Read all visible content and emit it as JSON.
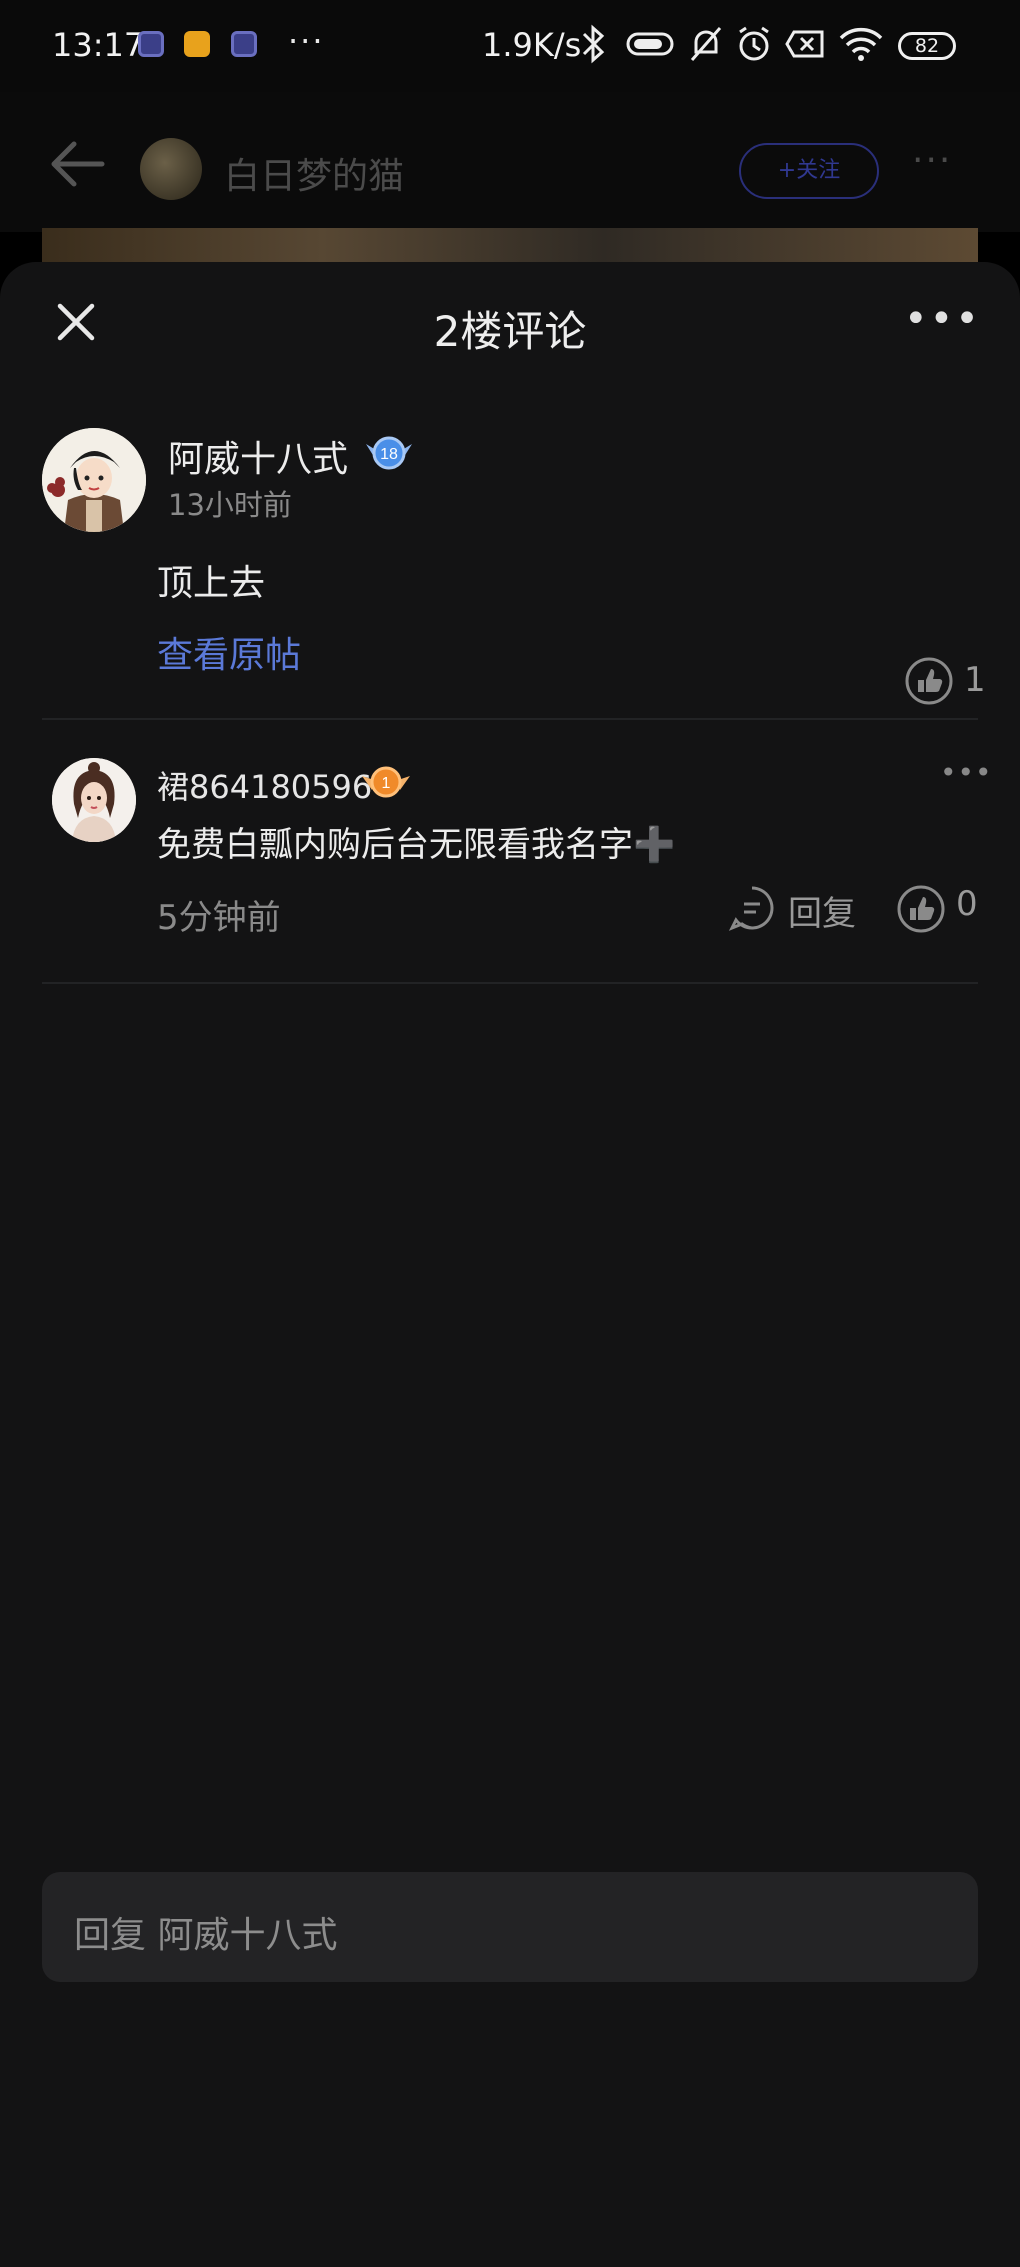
{
  "status_bar": {
    "time": "13:17",
    "more": "···",
    "net_speed": "1.9K/s",
    "battery": "82"
  },
  "background_header": {
    "name": "白日梦的猫",
    "follow_label": "+关注",
    "more": "···"
  },
  "sheet": {
    "title": "2楼评论",
    "more": "•••"
  },
  "main_comment": {
    "author": "阿威十八式",
    "level": "18",
    "time": "13小时前",
    "content": "顶上去",
    "view_original": "查看原帖",
    "likes": "1"
  },
  "replies": [
    {
      "author": "裙864180596",
      "level": "1",
      "content": "免费白瓢内购后台无限看我名字➕",
      "time": "5分钟前",
      "reply_label": "回复",
      "likes": "0",
      "more": "•••"
    }
  ],
  "input": {
    "placeholder": "回复 阿威十八式"
  },
  "colors": {
    "accent_link": "#5b79d8",
    "sheet_bg": "#131314",
    "level_blue": "#4a8fe8",
    "level_orange": "#f08a2a"
  }
}
